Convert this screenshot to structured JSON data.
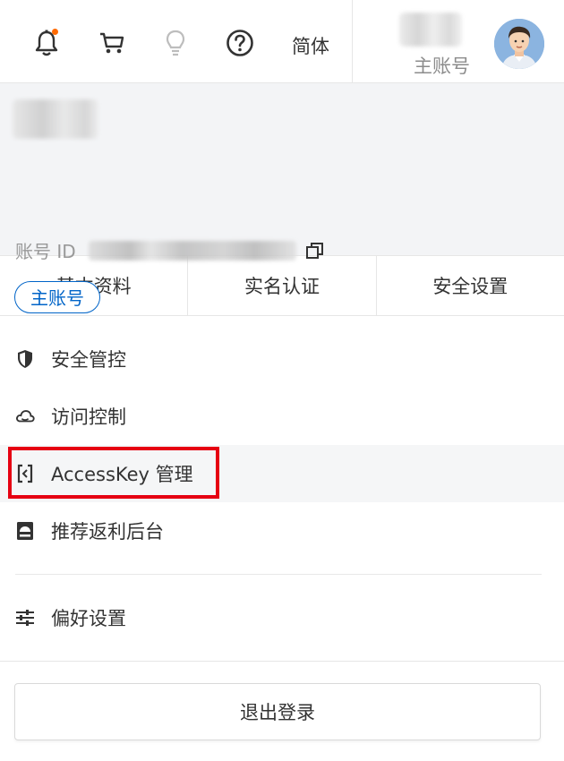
{
  "topbar": {
    "icons": [
      "bell-icon",
      "cart-icon",
      "lightbulb-icon",
      "help-icon"
    ],
    "language_label": "简体",
    "role_label": "主账号",
    "accent_color": "#ff6a00"
  },
  "account": {
    "id_label": "账号 ID",
    "role_tag": "主账号",
    "tag_color": "#0064c8"
  },
  "tabs": [
    {
      "label": "基本资料"
    },
    {
      "label": "实名认证"
    },
    {
      "label": "安全设置"
    }
  ],
  "menu": {
    "items": [
      {
        "label": "安全管控",
        "icon": "shield-icon"
      },
      {
        "label": "访问控制",
        "icon": "cloud-icon"
      },
      {
        "label": "AccessKey 管理",
        "icon": "key-bracket-icon",
        "highlighted": true
      },
      {
        "label": "推荐返利后台",
        "icon": "rebate-icon"
      }
    ],
    "preferences": {
      "label": "偏好设置",
      "icon": "sliders-icon"
    }
  },
  "logout_label": "退出登录",
  "highlight_box_color": "#e60012"
}
